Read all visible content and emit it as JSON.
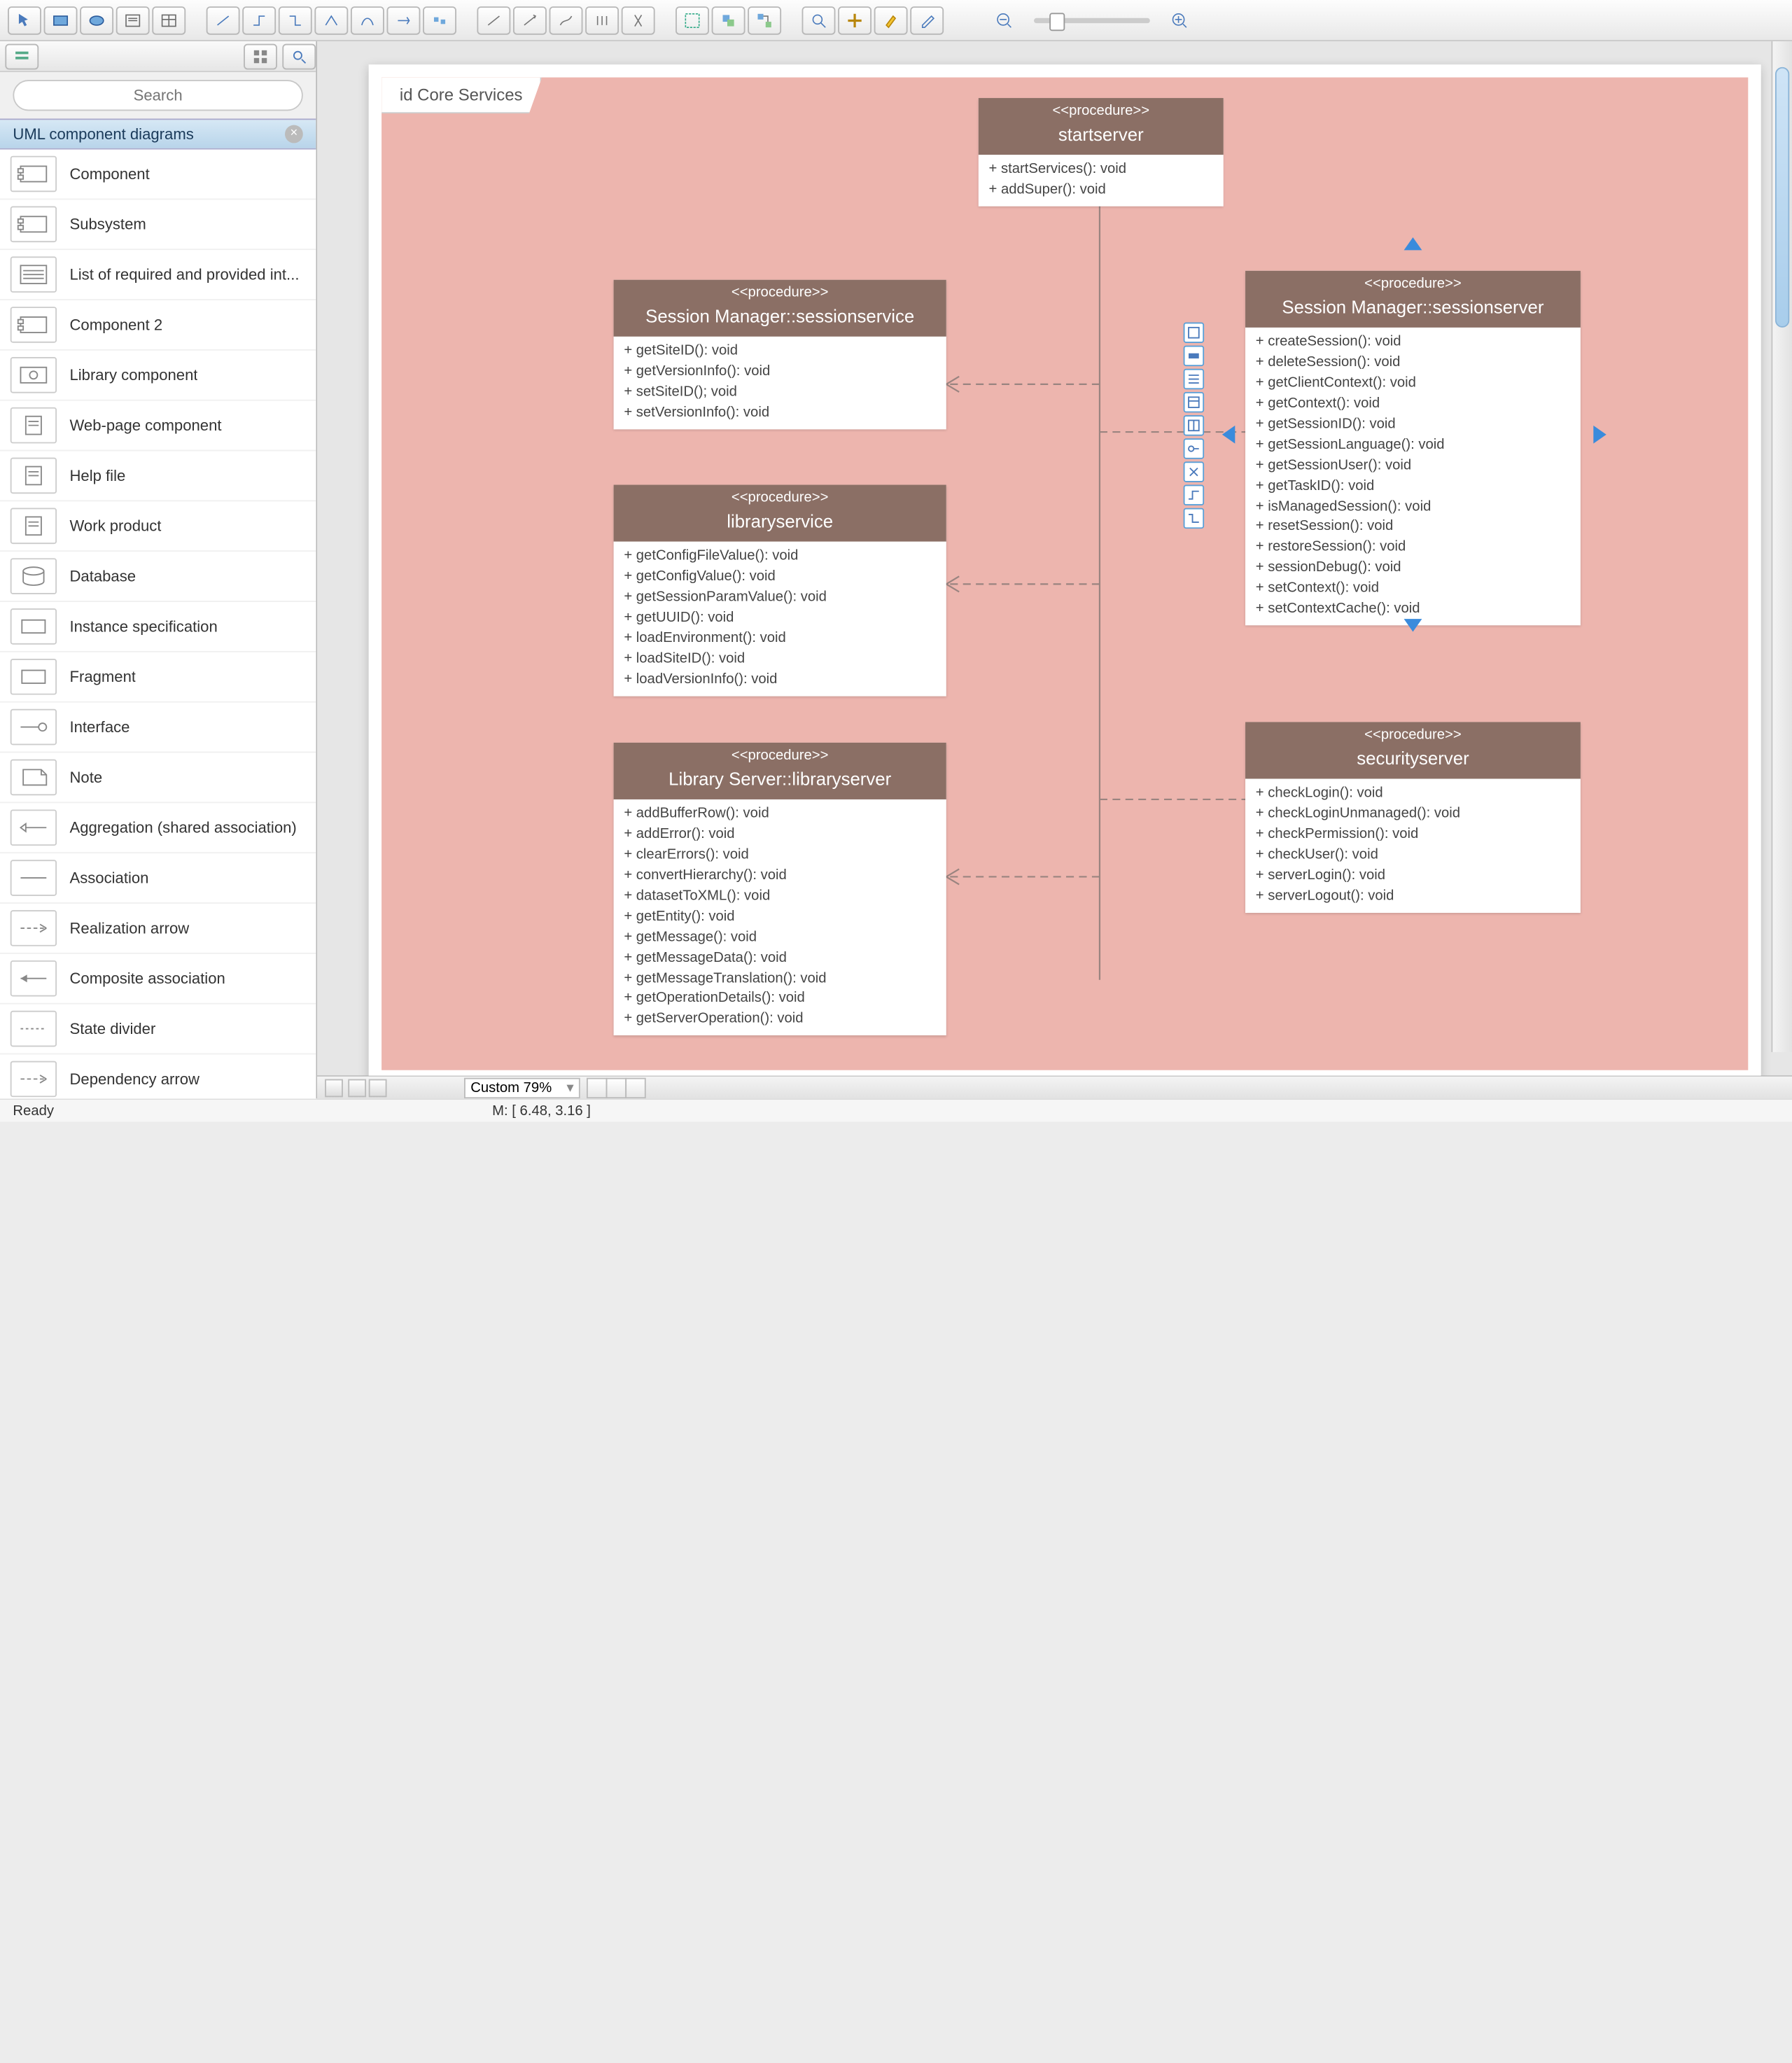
{
  "toolbar": {
    "groups": [
      [
        "pointer",
        "rect",
        "ellipse",
        "text",
        "table"
      ],
      [
        "connector-1",
        "connector-2",
        "connector-3",
        "connector-4",
        "connector-5",
        "connector-6",
        "connector-7"
      ],
      [
        "line-1",
        "line-2",
        "line-3",
        "line-4",
        "line-5"
      ],
      [
        "group-1",
        "group-2",
        "group-3"
      ],
      [
        "zoom-fit",
        "pan",
        "highlight",
        "eyedrop"
      ]
    ]
  },
  "sidebar": {
    "search_placeholder": "Search",
    "section_title": "UML component diagrams",
    "items": [
      {
        "label": "Component",
        "icon": "comp"
      },
      {
        "label": "Subsystem",
        "icon": "comp"
      },
      {
        "label": "List of required and provided int...",
        "icon": "list"
      },
      {
        "label": "Component 2",
        "icon": "comp"
      },
      {
        "label": "Library component",
        "icon": "gear"
      },
      {
        "label": "Web-page component",
        "icon": "page"
      },
      {
        "label": "Help file",
        "icon": "page"
      },
      {
        "label": "Work product",
        "icon": "page"
      },
      {
        "label": "Database",
        "icon": "db"
      },
      {
        "label": "Instance specification",
        "icon": "box"
      },
      {
        "label": "Fragment",
        "icon": "box"
      },
      {
        "label": "Interface",
        "icon": "lolli"
      },
      {
        "label": "Note",
        "icon": "note"
      },
      {
        "label": "Aggregation (shared association)",
        "icon": "arrow"
      },
      {
        "label": "Association",
        "icon": "line"
      },
      {
        "label": "Realization arrow",
        "icon": "dasharrow"
      },
      {
        "label": "Composite association",
        "icon": "filledarrow"
      },
      {
        "label": "State divider",
        "icon": "divider"
      },
      {
        "label": "Dependency arrow",
        "icon": "dasharrow"
      }
    ]
  },
  "diagram": {
    "frame_label": "id Core Services",
    "stereotype": "<<procedure>>",
    "cards": {
      "startserver": {
        "title": "startserver",
        "methods": [
          "+ startServices(): void",
          "+ addSuper(): void"
        ]
      },
      "sessionservice": {
        "title": "Session Manager::sessionservice",
        "methods": [
          "+ getSiteID(): void",
          "+ getVersionInfo(): void",
          "+ setSiteID(); void",
          "+ setVersionInfo(): void"
        ]
      },
      "libraryservice": {
        "title": "libraryservice",
        "methods": [
          "+ getConfigFileValue(): void",
          "+ getConfigValue(): void",
          "+ getSessionParamValue(): void",
          "+ getUUID(): void",
          "+ loadEnvironment(): void",
          "+ loadSiteID(): void",
          "+ loadVersionInfo(): void"
        ]
      },
      "libraryserver": {
        "title": "Library Server::libraryserver",
        "methods": [
          "+ addBufferRow(): void",
          "+ addError(): void",
          "+ clearErrors(): void",
          "+ convertHierarchy(): void",
          "+ datasetToXML(): void",
          "+ getEntity(): void",
          "+ getMessage(): void",
          "+ getMessageData(): void",
          "+ getMessageTranslation(): void",
          "+ getOperationDetails(): void",
          "+ getServerOperation(): void"
        ]
      },
      "sessionserver": {
        "title": "Session Manager::sessionserver",
        "methods": [
          "+ createSession(): void",
          "+ deleteSession(): void",
          "+ getClientContext(): void",
          "+ getContext(): void",
          "+ getSessionID(): void",
          "+ getSessionLanguage(): void",
          "+ getSessionUser(): void",
          "+ getTaskID(): void",
          "+ isManagedSession(): void",
          "+ resetSession(): void",
          "+ restoreSession(): void",
          "+ sessionDebug(): void",
          "+ setContext(): void",
          "+ setContextCache(): void"
        ]
      },
      "securityserver": {
        "title": "securityserver",
        "methods": [
          "+ checkLogin(): void",
          "+ checkLoginUnmanaged(): void",
          "+ checkPermission(): void",
          "+ checkUser(): void",
          "+ serverLogin(): void",
          "+ serverLogout(): void"
        ]
      }
    }
  },
  "footer": {
    "zoom": "Custom 79%",
    "status_left": "Ready",
    "status_coords": "M: [ 6.48, 3.16 ]"
  }
}
